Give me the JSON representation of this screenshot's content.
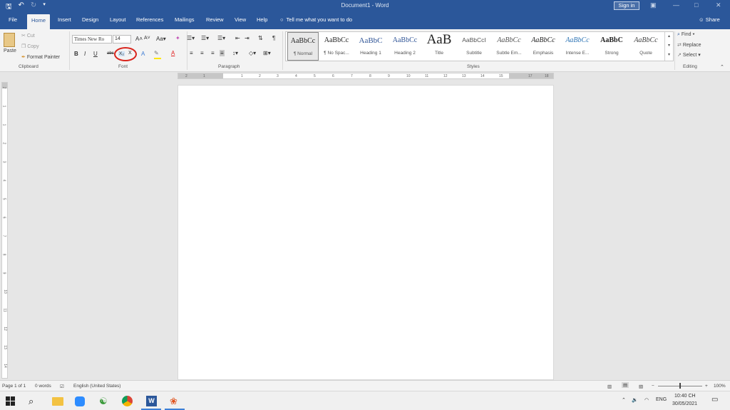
{
  "window": {
    "title": "Document1 - Word",
    "sign_in": "Sign in",
    "share": "Share"
  },
  "tabs": [
    "File",
    "Home",
    "Insert",
    "Design",
    "Layout",
    "References",
    "Mailings",
    "Review",
    "View",
    "Help"
  ],
  "tell_me": "Tell me what you want to do",
  "clipboard": {
    "paste": "Paste",
    "cut": "Cut",
    "copy": "Copy",
    "format_painter": "Format Painter",
    "label": "Clipboard"
  },
  "font": {
    "name": "Times New Ro",
    "size": "14",
    "label": "Font",
    "bold": "B",
    "italic": "I",
    "underline": "U",
    "strike": "abc",
    "subscript": "X₂",
    "superscript": "X"
  },
  "paragraph": {
    "label": "Paragraph"
  },
  "styles": {
    "label": "Styles",
    "items": [
      {
        "sample": "AaBbCc",
        "name": "¶ Normal"
      },
      {
        "sample": "AaBbCc",
        "name": "¶ No Spac..."
      },
      {
        "sample": "AaBbC",
        "name": "Heading 1"
      },
      {
        "sample": "AaBbCc",
        "name": "Heading 2"
      },
      {
        "sample": "AaB",
        "name": "Title"
      },
      {
        "sample": "AaBbCcI",
        "name": "Subtitle"
      },
      {
        "sample": "AaBbCc",
        "name": "Subtle Em..."
      },
      {
        "sample": "AaBbCc",
        "name": "Emphasis"
      },
      {
        "sample": "AaBbCc",
        "name": "Intense E..."
      },
      {
        "sample": "AaBbC",
        "name": "Strong"
      },
      {
        "sample": "AaBbCc",
        "name": "Quote"
      }
    ]
  },
  "editing": {
    "find": "Find",
    "replace": "Replace",
    "select": "Select",
    "label": "Editing"
  },
  "hruler_ticks": [
    "2",
    "1",
    "1",
    "2",
    "3",
    "4",
    "5",
    "6",
    "7",
    "8",
    "9",
    "10",
    "11",
    "12",
    "13",
    "14",
    "15",
    "17",
    "18"
  ],
  "vruler_ticks": [
    "2",
    "1",
    "1",
    "2",
    "3",
    "4",
    "5",
    "6",
    "7",
    "8",
    "9",
    "10",
    "11",
    "12",
    "13",
    "14"
  ],
  "status": {
    "page": "Page 1 of 1",
    "words": "0 words",
    "language": "English (United States)",
    "zoom": "100%"
  },
  "taskbar": {
    "time": "10:40 CH",
    "date": "30/05/2021",
    "lang": "ENG"
  },
  "colors": {
    "brand": "#2b579a",
    "annotation": "#d9241c"
  }
}
